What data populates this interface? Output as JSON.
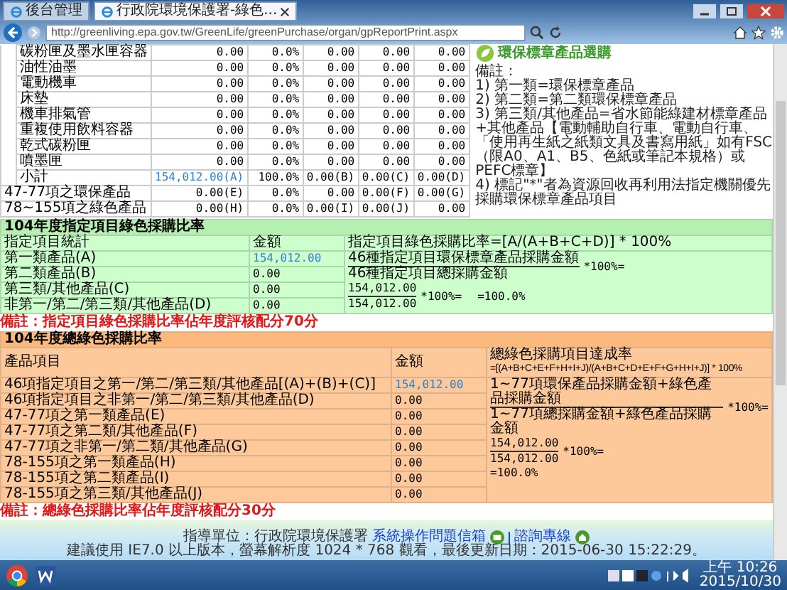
{
  "browser": {
    "url": "http://greenliving.epa.gov.tw/GreenLife/greenPurchase/organ/gpReportPrint.aspx",
    "tabs": [
      {
        "label": "後台管理",
        "selected": false
      },
      {
        "label": "行政院環境保護署-綠色...",
        "selected": true
      }
    ]
  },
  "spend_table": {
    "rows": [
      {
        "kind": "item",
        "cells": [
          "碳粉匣及墨水匣容器",
          "0.00",
          "0.0%",
          "0.00",
          "0.00",
          "0.00"
        ]
      },
      {
        "kind": "item",
        "cells": [
          "油性油墨",
          "0.00",
          "0.0%",
          "0.00",
          "0.00",
          "0.00"
        ]
      },
      {
        "kind": "item",
        "cells": [
          "電動機車",
          "0.00",
          "0.0%",
          "0.00",
          "0.00",
          "0.00"
        ]
      },
      {
        "kind": "item",
        "cells": [
          "床墊",
          "0.00",
          "0.0%",
          "0.00",
          "0.00",
          "0.00"
        ]
      },
      {
        "kind": "item",
        "cells": [
          "機車排氣管",
          "0.00",
          "0.0%",
          "0.00",
          "0.00",
          "0.00"
        ]
      },
      {
        "kind": "item",
        "cells": [
          "重複使用飲料容器",
          "0.00",
          "0.0%",
          "0.00",
          "0.00",
          "0.00"
        ]
      },
      {
        "kind": "item",
        "cells": [
          "乾式碳粉匣",
          "0.00",
          "0.0%",
          "0.00",
          "0.00",
          "0.00"
        ]
      },
      {
        "kind": "item",
        "cells": [
          "噴墨匣",
          "0.00",
          "0.0%",
          "0.00",
          "0.00",
          "0.00"
        ]
      },
      {
        "kind": "subtotal",
        "cells": [
          "小計",
          "154,012.00(A)",
          "100.0%",
          "0.00(B)",
          "0.00(C)",
          "0.00(D)"
        ]
      },
      {
        "kind": "summary",
        "cells": [
          "47-77項之環保產品",
          "0.00(E)",
          "0.0%",
          "0.00",
          "0.00(F)",
          "0.00(G)"
        ]
      },
      {
        "kind": "summary",
        "cells": [
          "78~155項之綠色產品",
          "0.00(H)",
          "0.0%",
          "0.00(I)",
          "0.00(J)",
          "0.00"
        ]
      }
    ]
  },
  "sidebar": {
    "logo_text": "環保標章產品選購"
  },
  "notes": {
    "title": "備註：",
    "items": [
      "1) 第一類=環保標章產品",
      "2) 第二類=第二類環保標章產品",
      "3) 第三類/其他產品=省水節能綠建材標章產品+其他產品【電動輔助自行車、電動自行車、「使用再生紙之紙類文具及書寫用紙」如有FSC（限A0、A1、B5、色紙或筆記本規格）或PEFC標章】",
      "4) 標記\"*\"者為資源回收再利用法指定機關優先採購環保標章產品項目"
    ]
  },
  "designated_table": {
    "title": "104年度指定項目綠色採購比率",
    "columns": [
      "指定項目統計",
      "金額",
      "指定項目綠色採購比率=[A/(A+B+C+D)] * 100%"
    ],
    "rows": [
      {
        "label": "第一類產品(A)",
        "amount": "154,012.00",
        "link": true
      },
      {
        "label": "第二類產品(B)",
        "amount": "0.00",
        "link": false
      },
      {
        "label": "第三類/其他產品(C)",
        "amount": "0.00",
        "link": false
      },
      {
        "label": "非第一/第二/第三類/其他產品(D)",
        "amount": "0.00",
        "link": false
      }
    ],
    "formula": {
      "numerator": "46種指定項目環保標章產品採購金額",
      "denominator": "46種指定項目總採購金額",
      "factor": "*100%=",
      "numerator_value": "154,012.00",
      "denominator_value": "154,012.00",
      "factor_2": "*100%=",
      "result": "=100.0%"
    },
    "note": "備註：指定項目綠色採購比率佔年度評核配分70分"
  },
  "total_table": {
    "title": "104年度總綠色採購比率",
    "columns": [
      "產品項目",
      "金額"
    ],
    "formula_title": "總綠色採購項目達成率",
    "formula_expression": "=[(A+B+C+E+F+H+I+J)/(A+B+C+D+E+F+G+H+I+J)] * 100%",
    "rows": [
      {
        "label": "46項指定項目之第一/第二/第三類/其他產品[(A)+(B)+(C)]",
        "amount": "154,012.00",
        "link": true
      },
      {
        "label": "46項指定項目之非第一/第二/第三類/其他產品(D)",
        "amount": "0.00",
        "link": false
      },
      {
        "label": "47-77項之第一類產品(E)",
        "amount": "0.00",
        "link": false
      },
      {
        "label": "47-77項之第二類/其他產品(F)",
        "amount": "0.00",
        "link": false
      },
      {
        "label": "47-77項之非第一/第二類/其他產品(G)",
        "amount": "0.00",
        "link": false
      },
      {
        "label": "78-155項之第一類產品(H)",
        "amount": "0.00",
        "link": false
      },
      {
        "label": "78-155項之第二類產品(I)",
        "amount": "0.00",
        "link": false
      },
      {
        "label": "78-155項之第三類/其他產品(J)",
        "amount": "0.00",
        "link": false
      }
    ],
    "formula": {
      "numerator": "1~77項環保產品採購金額+綠色產品採購金額",
      "denominator": "1~77項總採購金額+綠色產品採購金額",
      "factor": "*100%=",
      "numerator_value": "154,012.00",
      "denominator_value": "154,012.00",
      "factor_2": "*100%=",
      "result": "=100.0%"
    },
    "note": "備註：總綠色採購比率佔年度評核配分30分"
  },
  "footer": {
    "agency": "指導單位：行政院環境保護署",
    "links": [
      "系統操作問題信箱",
      "諮詢專線"
    ],
    "info": "建議使用 IE7.0 以上版本，螢幕解析度 1024 * 768 觀看，最後更新日期：2015-06-30 15:22:29。"
  },
  "taskbar": {
    "time": "上午 10:26",
    "date": "2015/10/30"
  }
}
